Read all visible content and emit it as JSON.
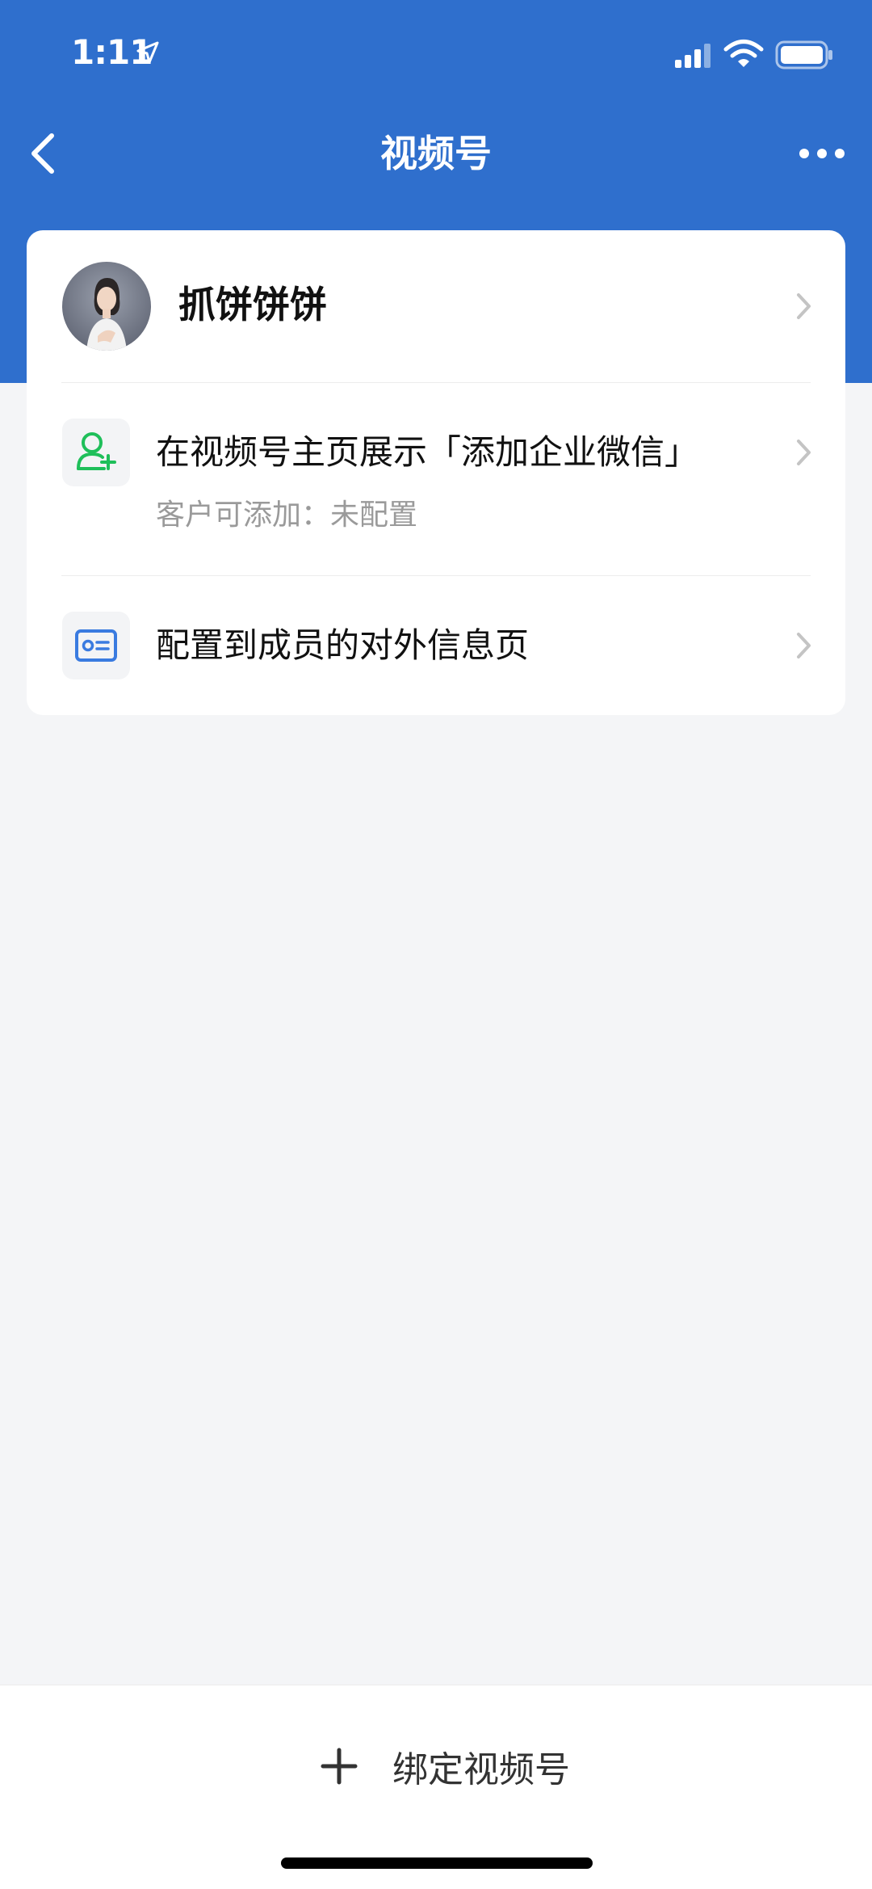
{
  "status_bar": {
    "time": "1:11"
  },
  "nav": {
    "title": "视频号"
  },
  "profile": {
    "name": "抓饼饼饼"
  },
  "items": [
    {
      "label": "在视频号主页展示「添加企业微信」",
      "sub": "客户可添加：未配置",
      "icon": "add-contact-icon",
      "icon_color": "#1fbf5a"
    },
    {
      "label": "配置到成员的对外信息页",
      "icon": "id-card-icon",
      "icon_color": "#3a7be0"
    }
  ],
  "bottom": {
    "bind_label": "绑定视频号"
  },
  "colors": {
    "header": "#2f6fcd",
    "background": "#f4f5f7"
  }
}
